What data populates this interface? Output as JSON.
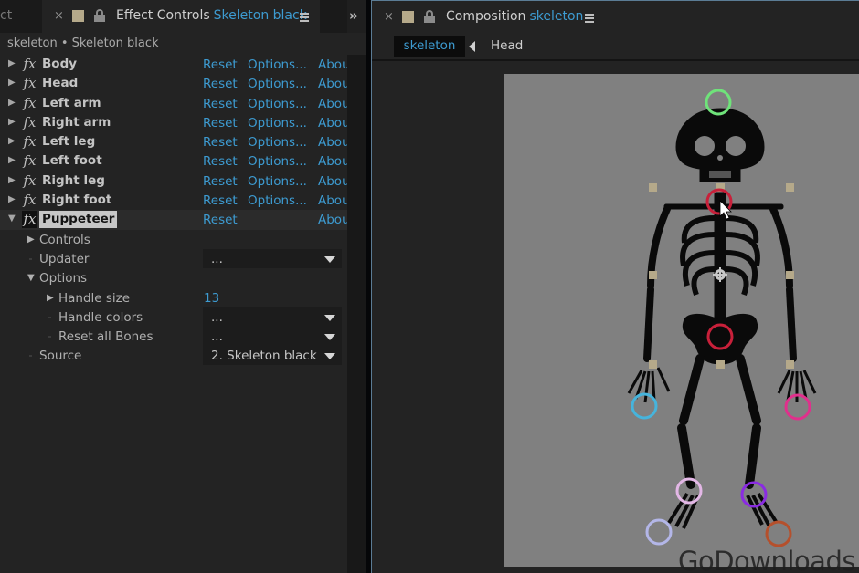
{
  "left_panel": {
    "prev_tab_fragment": "ct",
    "tab": {
      "title": "Effect Controls",
      "subtitle": "Skeleton black"
    },
    "overflow_label": "»",
    "breadcrumb": "skeleton • Skeleton black",
    "effects": [
      {
        "name": "Body",
        "reset": "Reset",
        "options": "Options...",
        "about": "Abou"
      },
      {
        "name": "Head",
        "reset": "Reset",
        "options": "Options...",
        "about": "Abou"
      },
      {
        "name": "Left arm",
        "reset": "Reset",
        "options": "Options...",
        "about": "Abou"
      },
      {
        "name": "Right arm",
        "reset": "Reset",
        "options": "Options...",
        "about": "Abou"
      },
      {
        "name": "Left leg",
        "reset": "Reset",
        "options": "Options...",
        "about": "Abou"
      },
      {
        "name": "Left foot",
        "reset": "Reset",
        "options": "Options...",
        "about": "Abou"
      },
      {
        "name": "Right leg",
        "reset": "Reset",
        "options": "Options...",
        "about": "Abou"
      },
      {
        "name": "Right foot",
        "reset": "Reset",
        "options": "Options...",
        "about": "Abou"
      },
      {
        "name": "Puppeteer",
        "reset": "Reset",
        "options": "",
        "about": "Abou"
      }
    ],
    "fx_glyph": "fx",
    "puppeteer_props": {
      "controls": {
        "label": "Controls"
      },
      "updater": {
        "label": "Updater",
        "value": "..."
      },
      "options": {
        "label": "Options"
      },
      "handle_size": {
        "label": "Handle size",
        "value": "13"
      },
      "handle_colors": {
        "label": "Handle colors",
        "value": "..."
      },
      "reset_all_bones": {
        "label": "Reset all Bones",
        "value": "..."
      },
      "source": {
        "label": "Source",
        "value": "2. Skeleton black"
      }
    }
  },
  "right_panel": {
    "tab": {
      "title": "Composition",
      "subtitle": "skeleton"
    },
    "path": {
      "comp": "skeleton",
      "layer": "Head"
    },
    "handle_colors": {
      "head": "#6fe37a",
      "neck": "#c8203a",
      "hip": "#c8203a",
      "left_hand": "#46b4dc",
      "right_hand": "#e0308c",
      "left_knee": "#e3b7e6",
      "right_knee": "#8a2be2",
      "left_foot": "#b3b6e8",
      "right_foot": "#b5502c"
    }
  },
  "colors": {
    "accent_blue": "#3d9bd1",
    "label_swatch": "#b5a98a",
    "canvas_gray": "#808080"
  },
  "watermark": "GoDownloads"
}
